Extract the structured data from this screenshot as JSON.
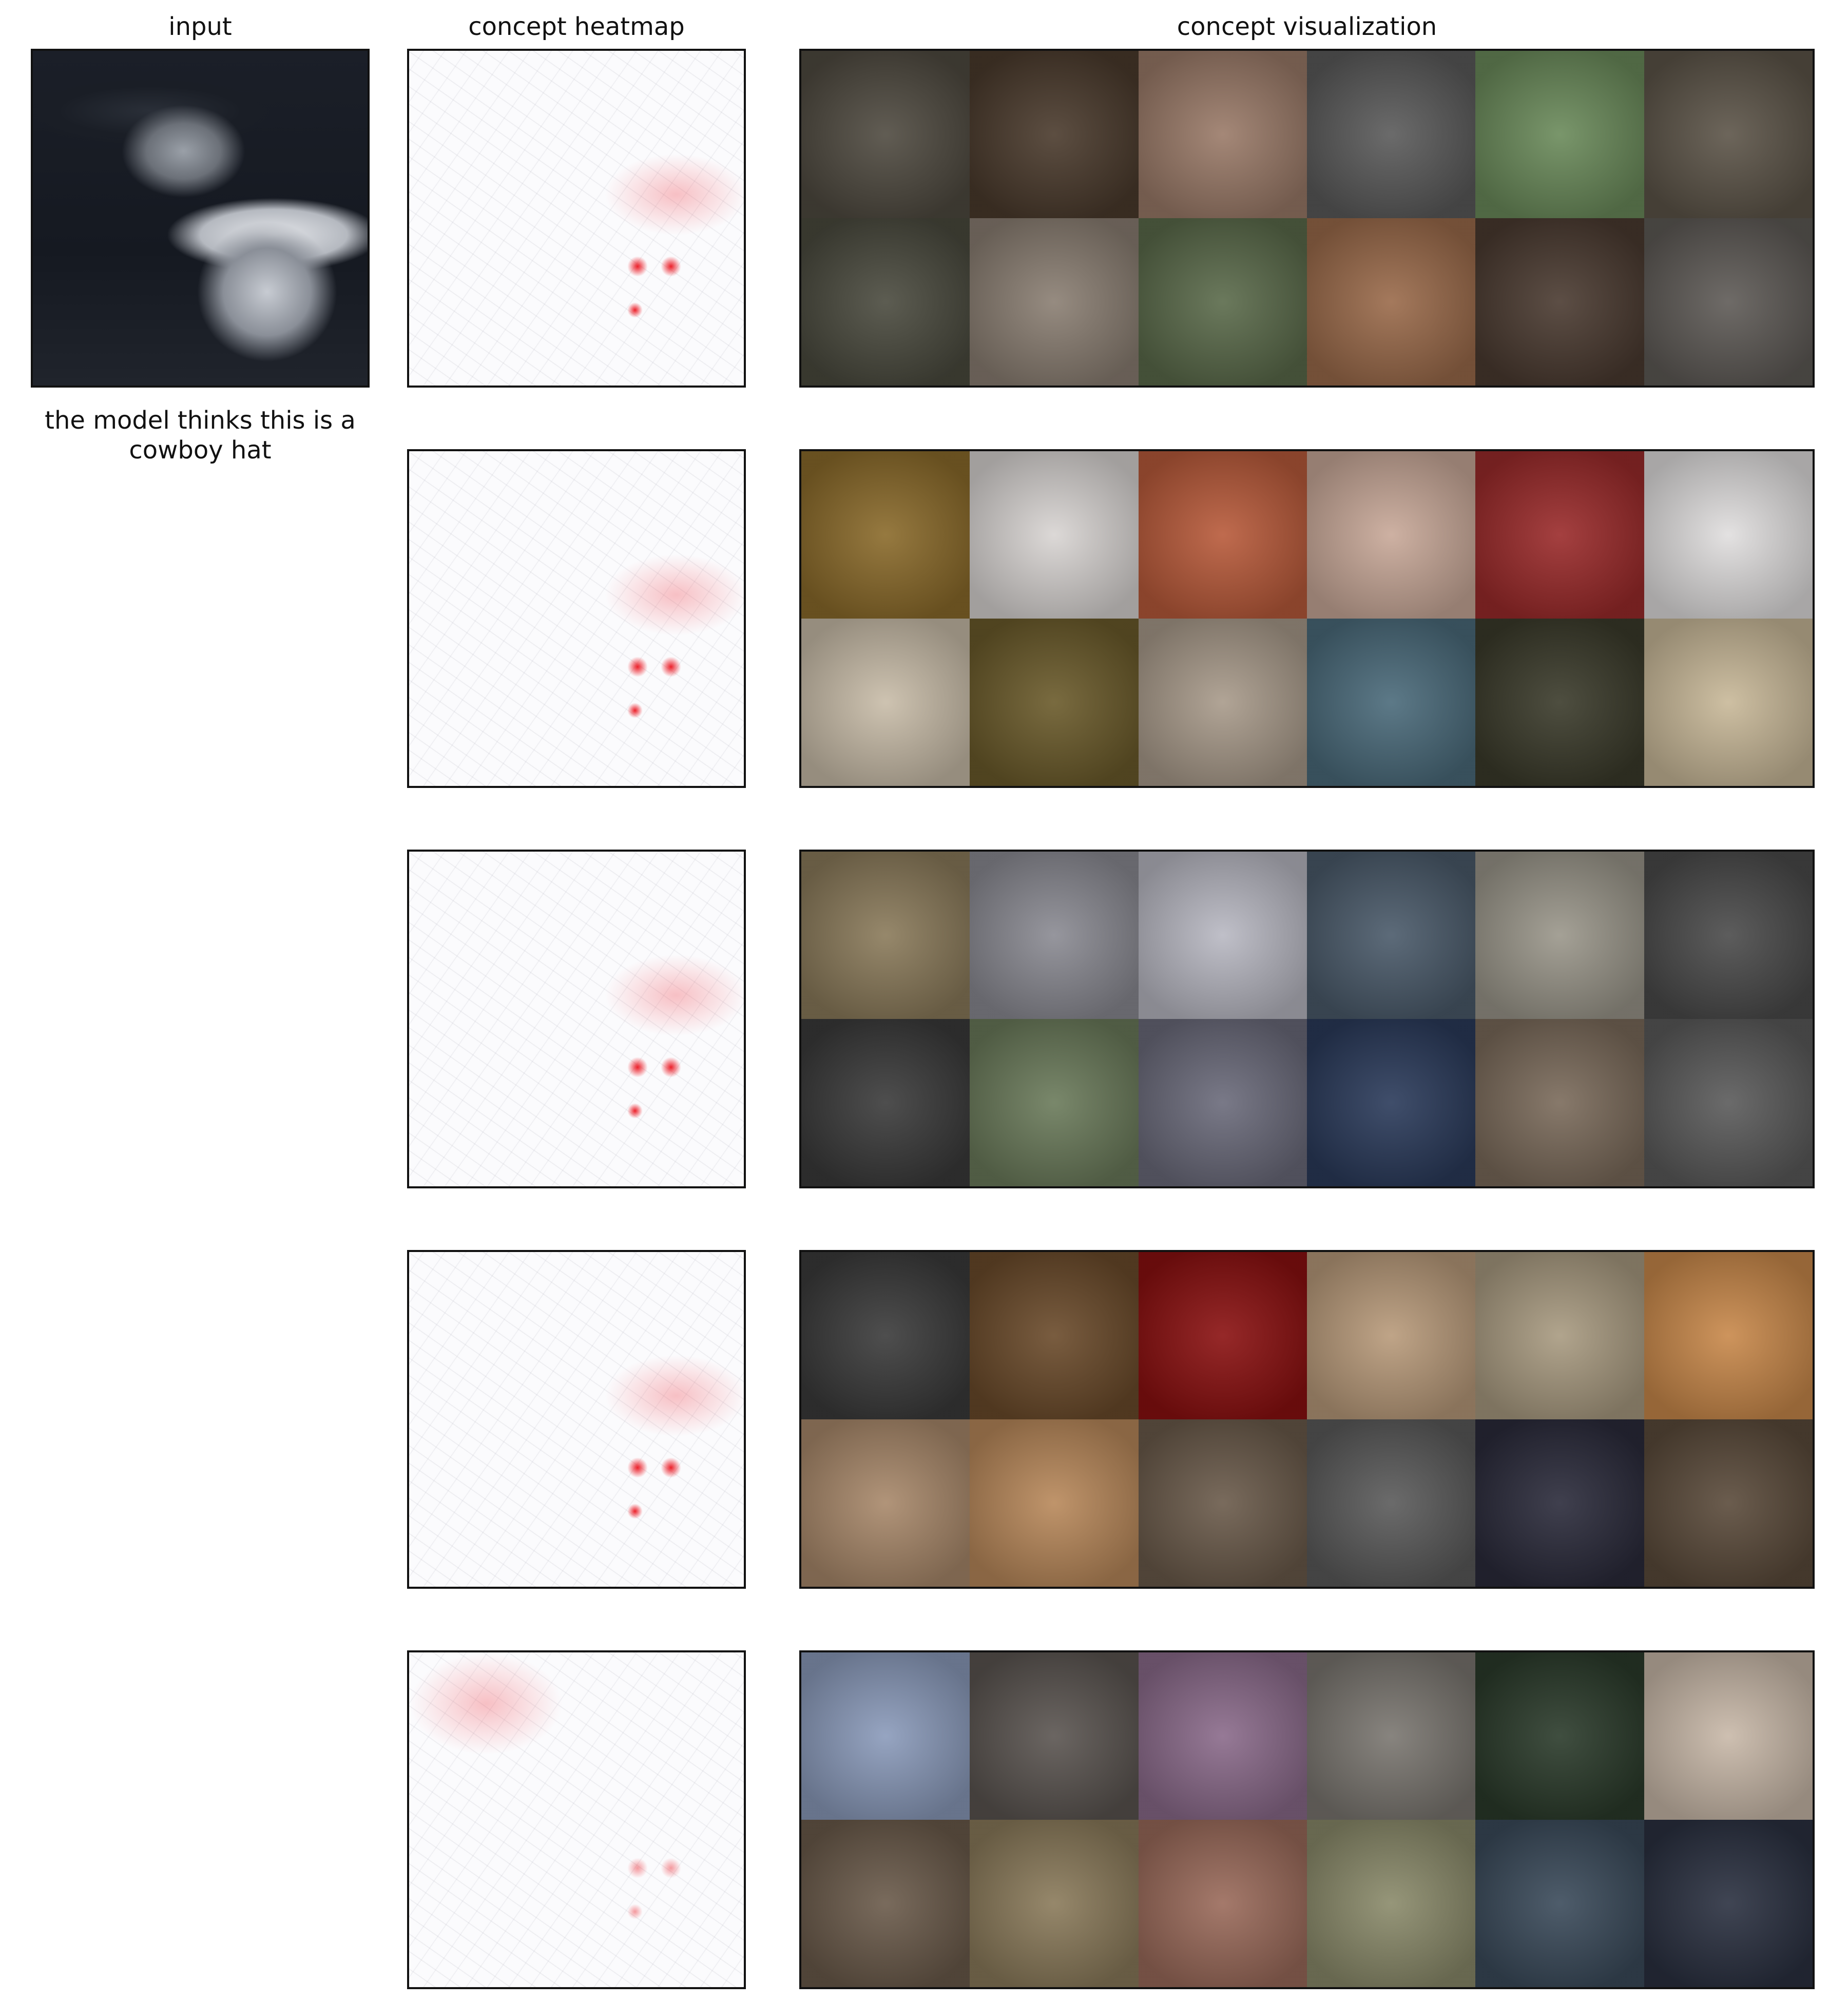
{
  "titles": {
    "input": "input",
    "heatmap": "concept heatmap",
    "visualization": "concept visualization"
  },
  "caption": "the model thinks this is a cowboy hat",
  "rows": [
    {
      "tiles": [
        "#4f4a40",
        "#4a3a2c",
        "#9a7a68",
        "#5a5a5a",
        "#6a8a5a",
        "#5c5448",
        "#4a4a3e",
        "#8a7e72",
        "#5a6a4a",
        "#9a6a4a",
        "#4a3a30",
        "#5e5a56"
      ]
    },
    {
      "tiles": [
        "#8a6a2a",
        "#d8d4d2",
        "#b85a3a",
        "#c8a898",
        "#9a2a2a",
        "#e0dede",
        "#c8bca8",
        "#6a5a2a",
        "#a89a8a",
        "#4a6a7a",
        "#3a3a2a",
        "#c8b898"
      ]
    },
    {
      "tiles": [
        "#8a7a5a",
        "#8a8a92",
        "#b8b8c2",
        "#4a5a6a",
        "#9a968a",
        "#4a4a4a",
        "#3a3a3a",
        "#6a7a5a",
        "#6a6a7a",
        "#2a3a5a",
        "#7a6a5a",
        "#5a5a5a"
      ]
    },
    {
      "tiles": [
        "#3a3a3a",
        "#6a4a2a",
        "#8a1010",
        "#b89a7a",
        "#a89a80",
        "#c8884a",
        "#a8886a",
        "#b8885a",
        "#6a5a4a",
        "#5a5a5a",
        "#2a2a3a",
        "#5a4a3a"
      ]
    },
    {
      "tiles": [
        "#8a9aba",
        "#5a5450",
        "#8a6a8a",
        "#7a7670",
        "#2a3a2a",
        "#c8b8a8",
        "#6a5a4a",
        "#8a7a5a",
        "#9a6a5a",
        "#8a8a6a",
        "#3a4a5a",
        "#2a3040"
      ]
    }
  ]
}
